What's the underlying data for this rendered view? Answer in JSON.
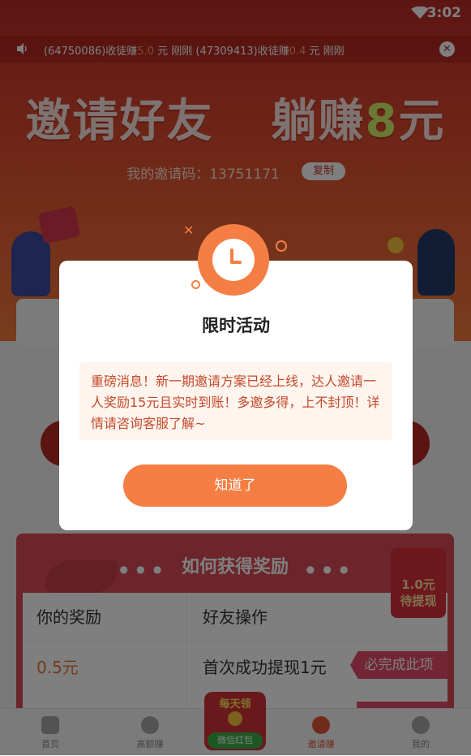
{
  "status_bar": {
    "time": "3:02"
  },
  "ticker": {
    "parts": [
      {
        "text": "(64750086)收徒赚"
      },
      {
        "amount": "5.0"
      },
      {
        "text": " 元 刚刚 (47309413)收徒赚"
      },
      {
        "amount": "0.4"
      },
      {
        "text": " 元 刚刚"
      }
    ]
  },
  "banner": {
    "headline_a": "邀请好友",
    "headline_b": "躺赚",
    "headline_num": "8",
    "headline_unit": "元",
    "invite_label": "我的邀请码：13751171",
    "copy_label": "复制"
  },
  "rewards": {
    "title": "如何获得奖励",
    "col1_header": "你的奖励",
    "col2_header": "好友操作",
    "row1_reward": "0.5元",
    "row1_action": "首次成功提现1元",
    "row1_tag": "必完成此项",
    "redpacket": "1.0元\n待提现"
  },
  "nav": {
    "items": [
      {
        "label": "首页"
      },
      {
        "label": "高额赚"
      },
      {
        "label": "微信红包",
        "top": "每天领"
      },
      {
        "label": "邀请赚"
      },
      {
        "label": "我的"
      }
    ],
    "active_index": 3
  },
  "dialog": {
    "title": "限时活动",
    "message": "重磅消息！新一期邀请方案已经上线，达人邀请一人奖励15元且实时到账！多邀多得，上不封顶！详情请咨询客服了解~",
    "confirm_label": "知道了"
  }
}
